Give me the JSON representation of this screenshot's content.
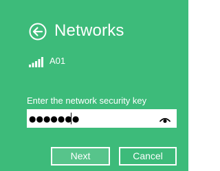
{
  "header": {
    "title": "Networks",
    "back_icon": "back-arrow-circle-icon"
  },
  "network": {
    "name": "A01",
    "signal_icon": "signal-strength-icon",
    "signal_bars_total": 5,
    "signal_bars_full": 5
  },
  "security_key": {
    "label": "Enter the network security key",
    "value": "●●●●●●●",
    "reveal_icon": "show-password-eye-icon"
  },
  "buttons": {
    "next_label": "Next",
    "cancel_label": "Cancel"
  },
  "colors": {
    "panel_background": "#3dbb7a",
    "primary_button_background": "#57c48b",
    "text": "#ffffff"
  }
}
